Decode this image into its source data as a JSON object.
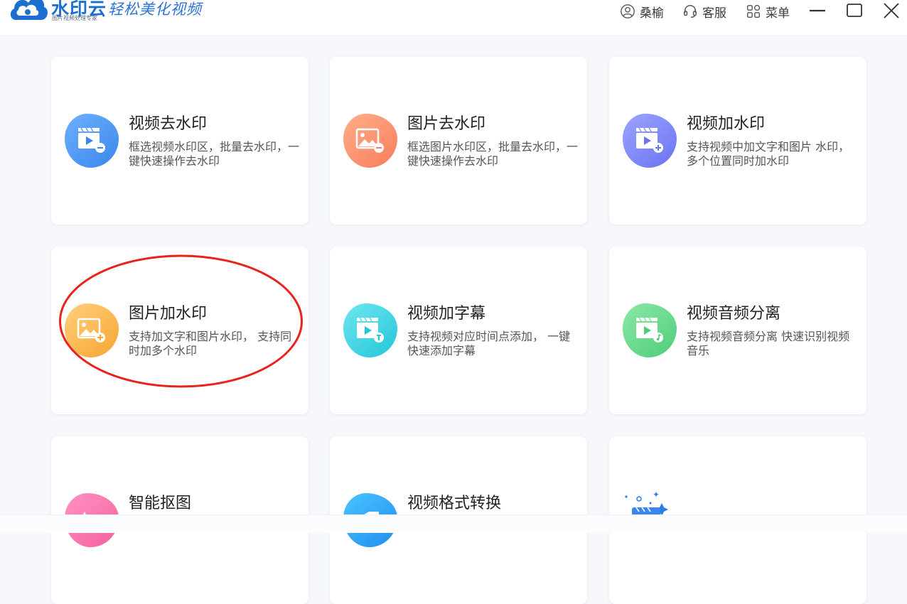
{
  "header": {
    "logo_name": "水印云",
    "logo_subtitle": "图片视频处理专家",
    "slogan": "轻松美化视频",
    "user_label": "桑榆",
    "service_label": "客服",
    "menu_label": "菜单"
  },
  "cards": [
    {
      "title": "视频去水印",
      "desc": "框选视频水印区，批量去水印，一键快速操作去水印",
      "icon": "video-remove-icon",
      "color": "#3b86ea"
    },
    {
      "title": "图片去水印",
      "desc": "框选图片水印区，批量去水印，一键快速操作去水印",
      "icon": "image-remove-icon",
      "color": "#f77d5c"
    },
    {
      "title": "视频加水印",
      "desc": "支持视频中加文字和图片 水印，多个位置同时加水印",
      "icon": "video-add-icon",
      "color": "#6b73f2"
    },
    {
      "title": "图片加水印",
      "desc": "支持加文字和图片水印， 支持同时加多个水印",
      "icon": "image-add-icon",
      "color": "#f6a532"
    },
    {
      "title": "视频加字幕",
      "desc": "支持视频对应时间点添加， 一键快速添加字幕",
      "icon": "video-subtitle-icon",
      "color": "#23c5d9"
    },
    {
      "title": "视频音频分离",
      "desc": "支持视频音频分离 快速识别视频音乐",
      "icon": "video-audio-icon",
      "color": "#4ccd7b"
    },
    {
      "title": "智能抠图",
      "desc": "",
      "icon": "cutout-icon",
      "color": "#f4609d"
    },
    {
      "title": "视频格式转换",
      "desc": "",
      "icon": "format-convert-icon",
      "color": "#1f8fef"
    },
    {
      "title": "",
      "desc": "",
      "icon": "more-features-icon",
      "color": "#2a7be4"
    }
  ],
  "annotation": {
    "color": "#e8231c"
  }
}
